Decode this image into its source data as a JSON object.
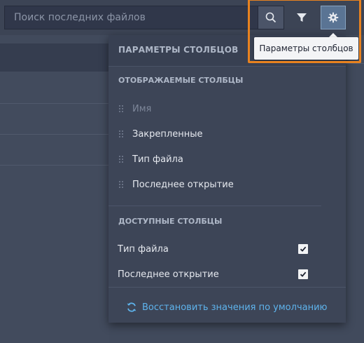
{
  "search": {
    "placeholder": "Поиск последних файлов"
  },
  "toolbar": {
    "settings_tooltip": "Параметры столбцов"
  },
  "panel": {
    "title": "ПАРАМЕТРЫ СТОЛБЦОВ",
    "displayed_heading": "ОТОБРАЖАЕМЫЕ СТОЛБЦЫ",
    "displayed_columns": [
      {
        "label": "Имя",
        "disabled": true
      },
      {
        "label": "Закрепленные",
        "disabled": false
      },
      {
        "label": "Тип файла",
        "disabled": false
      },
      {
        "label": "Последнее открытие",
        "disabled": false
      }
    ],
    "available_heading": "ДОСТУПНЫЕ СТОЛБЦЫ",
    "available_columns": [
      {
        "label": "Тип файла",
        "checked": true
      },
      {
        "label": "Последнее открытие",
        "checked": true
      }
    ],
    "reset_label": "Восстановить значения по умолчанию"
  },
  "colors": {
    "accent": "#5eb3ec",
    "highlight": "#e8821f",
    "background": "#414a5c",
    "panel": "#3d4557"
  }
}
